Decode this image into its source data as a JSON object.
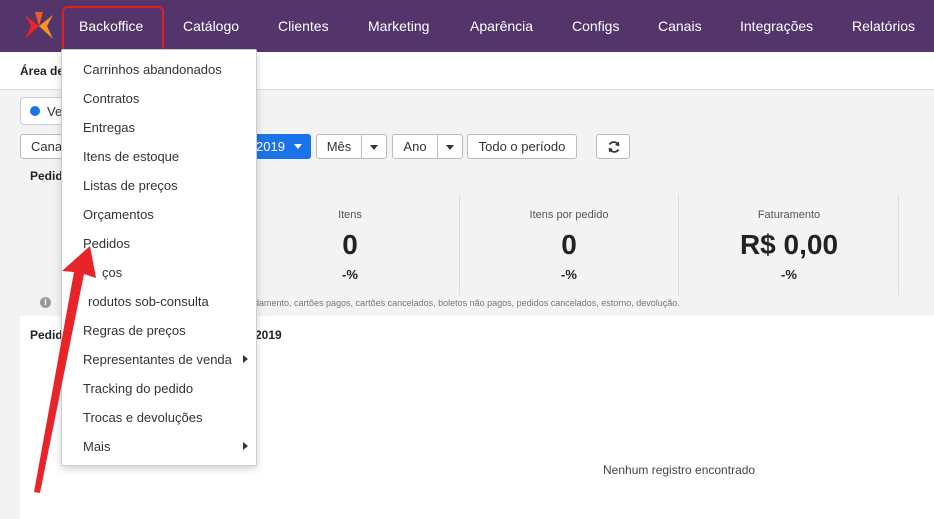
{
  "nav": {
    "items": [
      "Backoffice",
      "Catálogo",
      "Clientes",
      "Marketing",
      "Aparência",
      "Configs",
      "Canais",
      "Integrações",
      "Relatórios"
    ]
  },
  "page": {
    "title": "Área de",
    "radio_label": "Ve",
    "filter_canal": "Canal",
    "date_text": "2019",
    "period_mes": "Mês",
    "period_ano": "Ano",
    "period_todo": "Todo o período",
    "section_pedidos": "Pedid",
    "section_pedidos_periodo": "Pedid",
    "section_pedidos_periodo_tail": "2019"
  },
  "stats": [
    {
      "label": "Itens",
      "value": "0",
      "pct": "-%"
    },
    {
      "label": "Itens por pedido",
      "value": "0",
      "pct": "-%"
    },
    {
      "label": "Faturamento",
      "value": "R$ 0,00",
      "pct": "-%"
    }
  ],
  "info": {
    "icon": "info-icon",
    "text": "damento, cartões pagos, cartões cancelados, boletos não pagos, pedidos cancelados, estorno, devolução."
  },
  "empty": "Nenhum registro encontrado",
  "dropdown": {
    "items": [
      {
        "label": "Carrinhos abandonados"
      },
      {
        "label": "Contratos"
      },
      {
        "label": "Entregas"
      },
      {
        "label": "Itens de estoque"
      },
      {
        "label": "Listas de preços"
      },
      {
        "label": "Orçamentos"
      },
      {
        "label": "Pedidos"
      },
      {
        "label": "ços"
      },
      {
        "label": "rodutos sob-consulta"
      },
      {
        "label": "Regras de preços"
      },
      {
        "label": "Representantes de venda",
        "submenu": true
      },
      {
        "label": "Tracking do pedido"
      },
      {
        "label": "Trocas e devoluções"
      },
      {
        "label": "Mais",
        "submenu": true
      }
    ]
  },
  "colors": {
    "nav_bg": "#54356b",
    "primary": "#1a73e8",
    "highlight": "#e02020",
    "arrow": "#e8232a"
  }
}
